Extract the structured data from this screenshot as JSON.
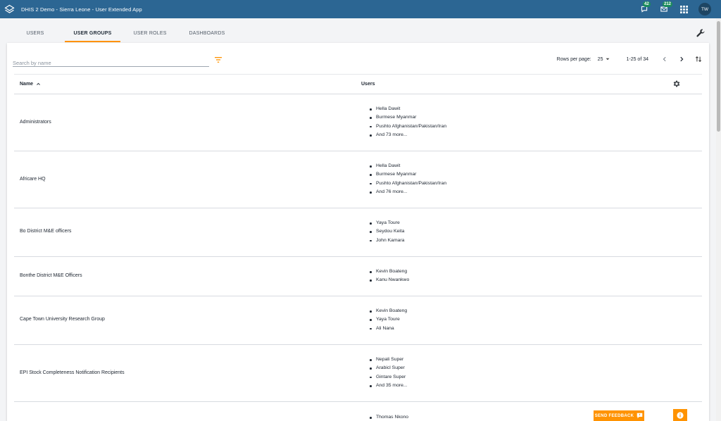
{
  "topbar": {
    "title": "DHIS 2 Demo - Sierra Leone - User Extended App",
    "interpretations_count": "42",
    "messages_count": "212",
    "user_initials": "TW",
    "logo_icon": "dhis2-logo-icon",
    "apps_icon": "apps-grid-icon"
  },
  "tabs": [
    {
      "label": "USERS",
      "active": false
    },
    {
      "label": "USER GROUPS",
      "active": true
    },
    {
      "label": "USER ROLES",
      "active": false
    },
    {
      "label": "DASHBOARDS",
      "active": false
    }
  ],
  "toolbar": {
    "search_placeholder": "Search by name",
    "search_value": "",
    "rows_per_page_label": "Rows per page:",
    "rows_per_page_value": "25",
    "range_label": "1-25 of 34"
  },
  "table": {
    "col_name": "Name",
    "col_users": "Users",
    "sort_indicator": "^",
    "rows": [
      {
        "name": "Administrators",
        "users": [
          "Hella Dawit",
          "Burmese Myanmar",
          "Pushto Afghanistan/Pakistan/Iran",
          "And 73 more..."
        ]
      },
      {
        "name": "Africare HQ",
        "users": [
          "Hella Dawit",
          "Burmese Myanmar",
          "Pushto Afghanistan/Pakistan/Iran",
          "And 76 more..."
        ]
      },
      {
        "name": "Bo District M&E officers",
        "users": [
          "Yaya Toure",
          "Seydou Keita",
          "John Kamara"
        ]
      },
      {
        "name": "Bonthe District M&E Officers",
        "users": [
          "Kevin Boateng",
          "Kanu Nwankwo"
        ]
      },
      {
        "name": "Cape Town University Research Group",
        "users": [
          "Kevin Boateng",
          "Yaya Toure",
          "Ali Nana"
        ]
      },
      {
        "name": "EPI Stock Completeness Notification Recipients",
        "users": [
          "Nepali Super",
          "Arabicl Super",
          "Gintare Super",
          "And 35 more..."
        ]
      },
      {
        "name": "",
        "users": [
          "Thomas Nkono"
        ]
      }
    ]
  },
  "feedback": {
    "label": "SEND FEEDBACK"
  },
  "colors": {
    "header": "#2c6693",
    "accent": "#ff9302",
    "badge": "#1b8c5b"
  }
}
